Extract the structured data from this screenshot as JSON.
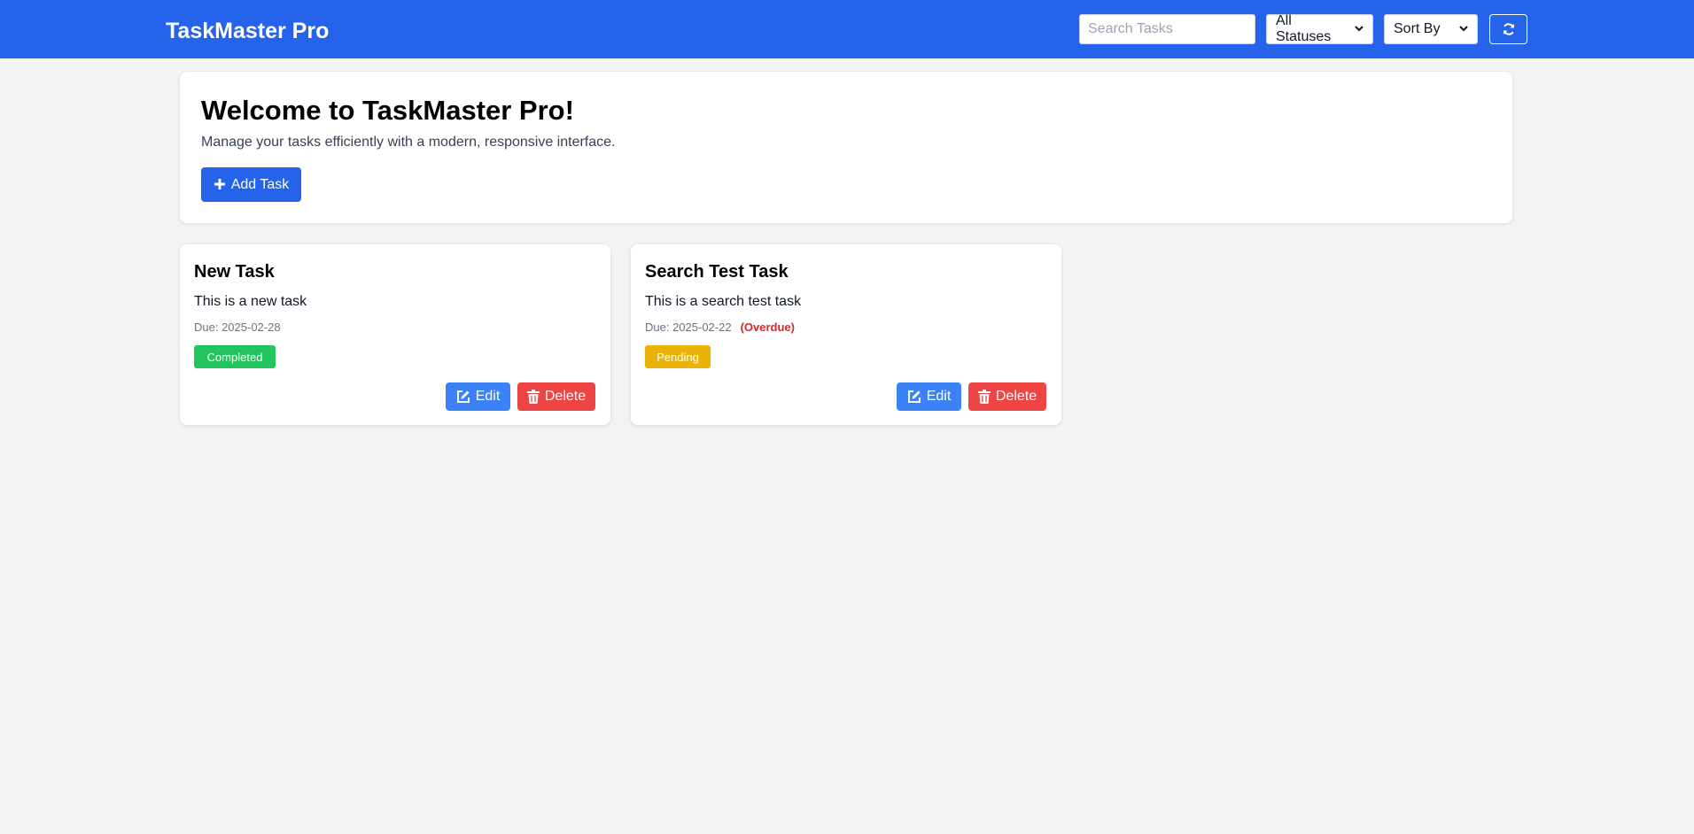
{
  "header": {
    "brand": "TaskMaster Pro",
    "search_placeholder": "Search Tasks",
    "status_filter": "All Statuses",
    "sort_by": "Sort By",
    "refresh_icon": "refresh-icon"
  },
  "welcome": {
    "title": "Welcome to TaskMaster Pro!",
    "subtitle": "Manage your tasks efficiently with a modern, responsive interface.",
    "add_task_label": "Add Task"
  },
  "tasks": [
    {
      "title": "New Task",
      "description": "This is a new task",
      "due": "Due: 2025-02-28",
      "overdue": "",
      "status": "Completed",
      "status_color": "#22c55e",
      "edit_label": "Edit",
      "delete_label": "Delete"
    },
    {
      "title": "Search Test Task",
      "description": "This is a search test task",
      "due": "Due: 2025-02-22",
      "overdue": "(Overdue)",
      "status": "Pending",
      "status_color": "#eab308",
      "edit_label": "Edit",
      "delete_label": "Delete"
    }
  ],
  "colors": {
    "primary": "#2563eb",
    "edit": "#3b82f6",
    "delete": "#ef4444",
    "overdue": "#dc2626",
    "background": "#f2f3f5"
  }
}
